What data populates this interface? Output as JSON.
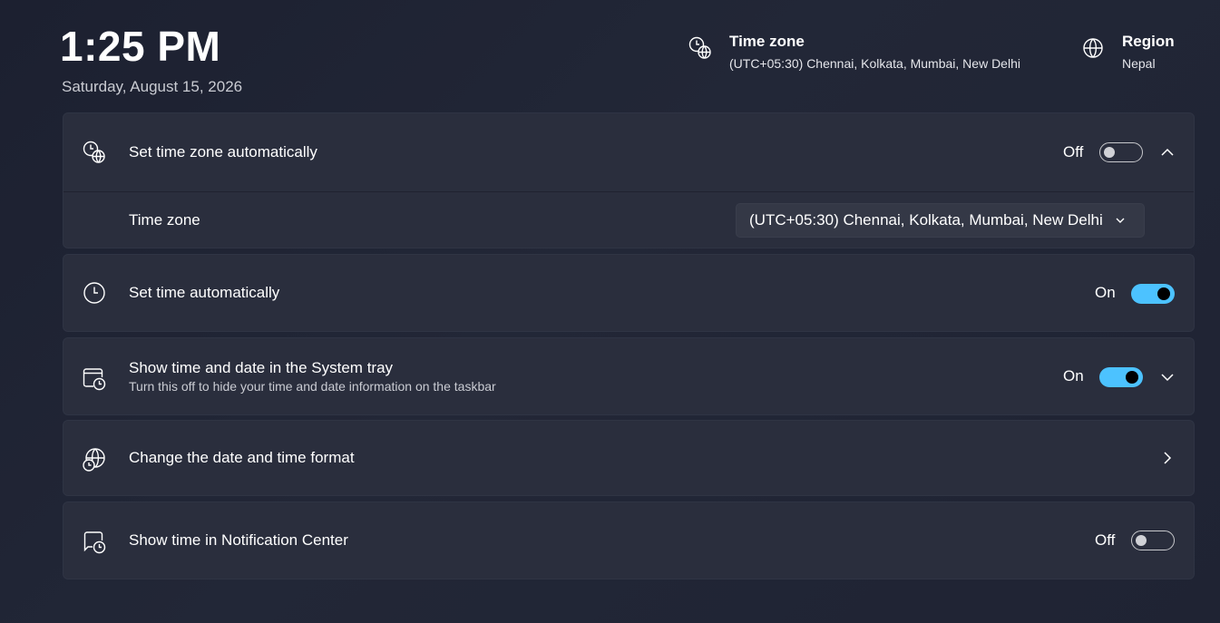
{
  "header": {
    "time": "1:25 PM",
    "date": "Saturday, August 15, 2026",
    "timezone": {
      "title": "Time zone",
      "value": "(UTC+05:30) Chennai, Kolkata, Mumbai, New Delhi",
      "icon": "clock-globe-icon"
    },
    "region": {
      "title": "Region",
      "value": "Nepal",
      "icon": "globe-icon"
    }
  },
  "settings": {
    "auto_timezone": {
      "label": "Set time zone automatically",
      "state": "Off",
      "icon": "clock-globe-icon"
    },
    "timezone_select": {
      "label": "Time zone",
      "value": "(UTC+05:30) Chennai, Kolkata, Mumbai, New Delhi"
    },
    "auto_time": {
      "label": "Set time automatically",
      "state": "On",
      "icon": "clock-icon"
    },
    "tray": {
      "label": "Show time and date in the System tray",
      "description": "Turn this off to hide your time and date information on the taskbar",
      "state": "On",
      "icon": "calendar-clock-icon"
    },
    "format": {
      "label": "Change the date and time format",
      "icon": "globe-clock-icon"
    },
    "notification": {
      "label": "Show time in Notification Center",
      "state": "Off",
      "icon": "notification-clock-icon"
    }
  },
  "colors": {
    "accent": "#4cc2ff",
    "card": "#2a2e3d",
    "background": "#1f2333"
  }
}
